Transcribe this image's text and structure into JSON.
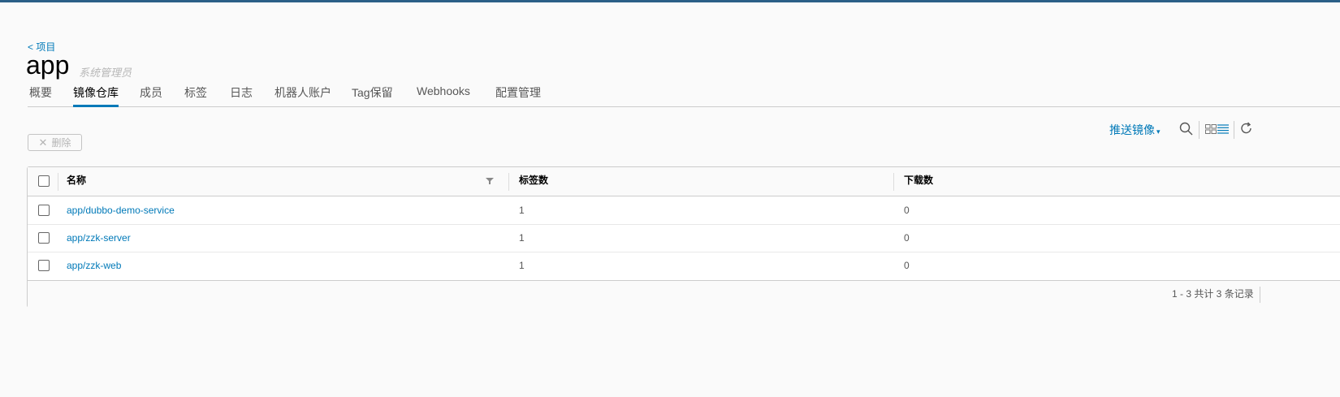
{
  "header": {
    "back_label": "< 项目",
    "project_name": "app",
    "role": "系统管理员"
  },
  "tabs": [
    {
      "label": "概要",
      "active": false
    },
    {
      "label": "镜像仓库",
      "active": true
    },
    {
      "label": "成员",
      "active": false
    },
    {
      "label": "标签",
      "active": false
    },
    {
      "label": "日志",
      "active": false
    },
    {
      "label": "机器人账户",
      "active": false
    },
    {
      "label": "Tag保留",
      "active": false
    },
    {
      "label": "Webhooks",
      "active": false
    },
    {
      "label": "配置管理",
      "active": false
    }
  ],
  "toolbar": {
    "delete_label": "删除",
    "push_image_label": "推送镜像"
  },
  "table": {
    "columns": [
      "名称",
      "标签数",
      "下载数"
    ],
    "rows": [
      {
        "name": "app/dubbo-demo-service",
        "tags": "1",
        "pulls": "0"
      },
      {
        "name": "app/zzk-server",
        "tags": "1",
        "pulls": "0"
      },
      {
        "name": "app/zzk-web",
        "tags": "1",
        "pulls": "0"
      }
    ],
    "footer": "1 - 3 共计 3 条记录"
  },
  "colors": {
    "accent": "#0079b8",
    "topbar": "#2b5f87"
  },
  "icons": [
    "search-icon",
    "card-view-icon",
    "list-view-icon",
    "refresh-icon",
    "filter-icon",
    "close-icon",
    "chevron-down-icon"
  ]
}
